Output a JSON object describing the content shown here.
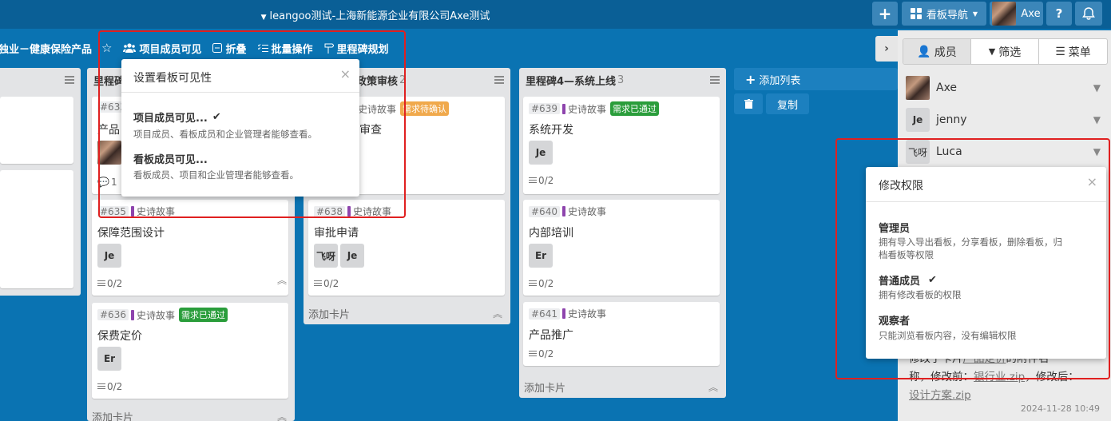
{
  "topbar": {
    "title": "leangoo测试-上海新能源企业有限公司Axe测试",
    "add_label": "+",
    "nav_label": "看板导航",
    "user_name": "Axe",
    "help_label": "?"
  },
  "board": {
    "title": "独业－健康保险产品",
    "visibility_label": "项目成员可见",
    "collapse_label": "折叠",
    "batch_label": "批量操作",
    "milestone_label": "里程碑规划"
  },
  "visibility_popover": {
    "title": "设置看板可见性",
    "options": [
      {
        "title": "项目成员可见...",
        "desc": "项目成员、看板成员和企业管理者能够查看。",
        "checked": true
      },
      {
        "title": "看板成员可见...",
        "desc": "看板成员、项目和企业管理者能够查看。",
        "checked": false
      }
    ]
  },
  "lists": [
    {
      "title": "",
      "count": "",
      "cards": []
    },
    {
      "title": "里程碑",
      "count": "",
      "cards": [
        {
          "id": "#633",
          "title": "产品",
          "comments": "1"
        },
        {
          "id": "#635",
          "epic": "史诗故事",
          "title": "保障范围设计",
          "members": [
            "Je"
          ],
          "checklist": "0/2"
        },
        {
          "id": "#636",
          "epic": "史诗故事",
          "tag": "需求已通过",
          "title": "保费定价",
          "members": [
            "Er"
          ],
          "checklist": "0/2"
        }
      ],
      "add_card": "添加卡片"
    },
    {
      "title": "政策审核",
      "count": "2",
      "cards": [
        {
          "id": "",
          "epic": "史诗故事",
          "tag": "需求待确认",
          "title": "审查"
        },
        {
          "id": "#638",
          "epic": "史诗故事",
          "title": "审批申请",
          "members": [
            "飞呀",
            "Je"
          ],
          "checklist": "0/2"
        }
      ],
      "add_card": "添加卡片"
    },
    {
      "title": "里程碑4—系统上线",
      "count": "3",
      "cards": [
        {
          "id": "#639",
          "epic": "史诗故事",
          "tag": "需求已通过",
          "title": "系统开发",
          "members": [
            "Je"
          ],
          "checklist": "0/2"
        },
        {
          "id": "#640",
          "epic": "史诗故事",
          "title": "内部培训",
          "members": [
            "Er"
          ],
          "checklist": "0/2"
        },
        {
          "id": "#641",
          "epic": "史诗故事",
          "title": "产品推广",
          "checklist": "0/2"
        }
      ],
      "add_card": "添加卡片"
    }
  ],
  "add_list": {
    "label": "添加列表",
    "copy_label": "复制"
  },
  "sidebar": {
    "tabs": [
      "成员",
      "筛选",
      "菜单"
    ],
    "members": [
      {
        "initials": "",
        "name": "Axe"
      },
      {
        "initials": "Je",
        "name": "jenny"
      },
      {
        "initials": "飞呀",
        "name": "Luca"
      }
    ],
    "activity": {
      "line1_prefix": "修改了卡片",
      "line1_link": "产品定价",
      "line1_suffix": "的附件名",
      "line2_prefix": "称，修改前：",
      "line2_link": "银行业.zip",
      "line2_suffix": "，修改后：",
      "line3_link": "设计方案.zip",
      "time": "2024-11-28 10:49"
    }
  },
  "permission_popover": {
    "title": "修改权限",
    "options": [
      {
        "title": "管理员",
        "desc": "拥有导入导出看板，分享看板，删除看板，归档看板等权限",
        "checked": false
      },
      {
        "title": "普通成员",
        "desc": "拥有修改看板的权限",
        "checked": true
      },
      {
        "title": "观察者",
        "desc": "只能浏览看板内容，没有编辑权限",
        "checked": false
      }
    ]
  },
  "colors": {
    "topbar": "#0a5f96",
    "board_bg": "#0a73b2",
    "highlight": "#e02020",
    "tag_green": "#2a9d3b",
    "tag_orange": "#f0a94c",
    "epic": "#8e44ad"
  }
}
